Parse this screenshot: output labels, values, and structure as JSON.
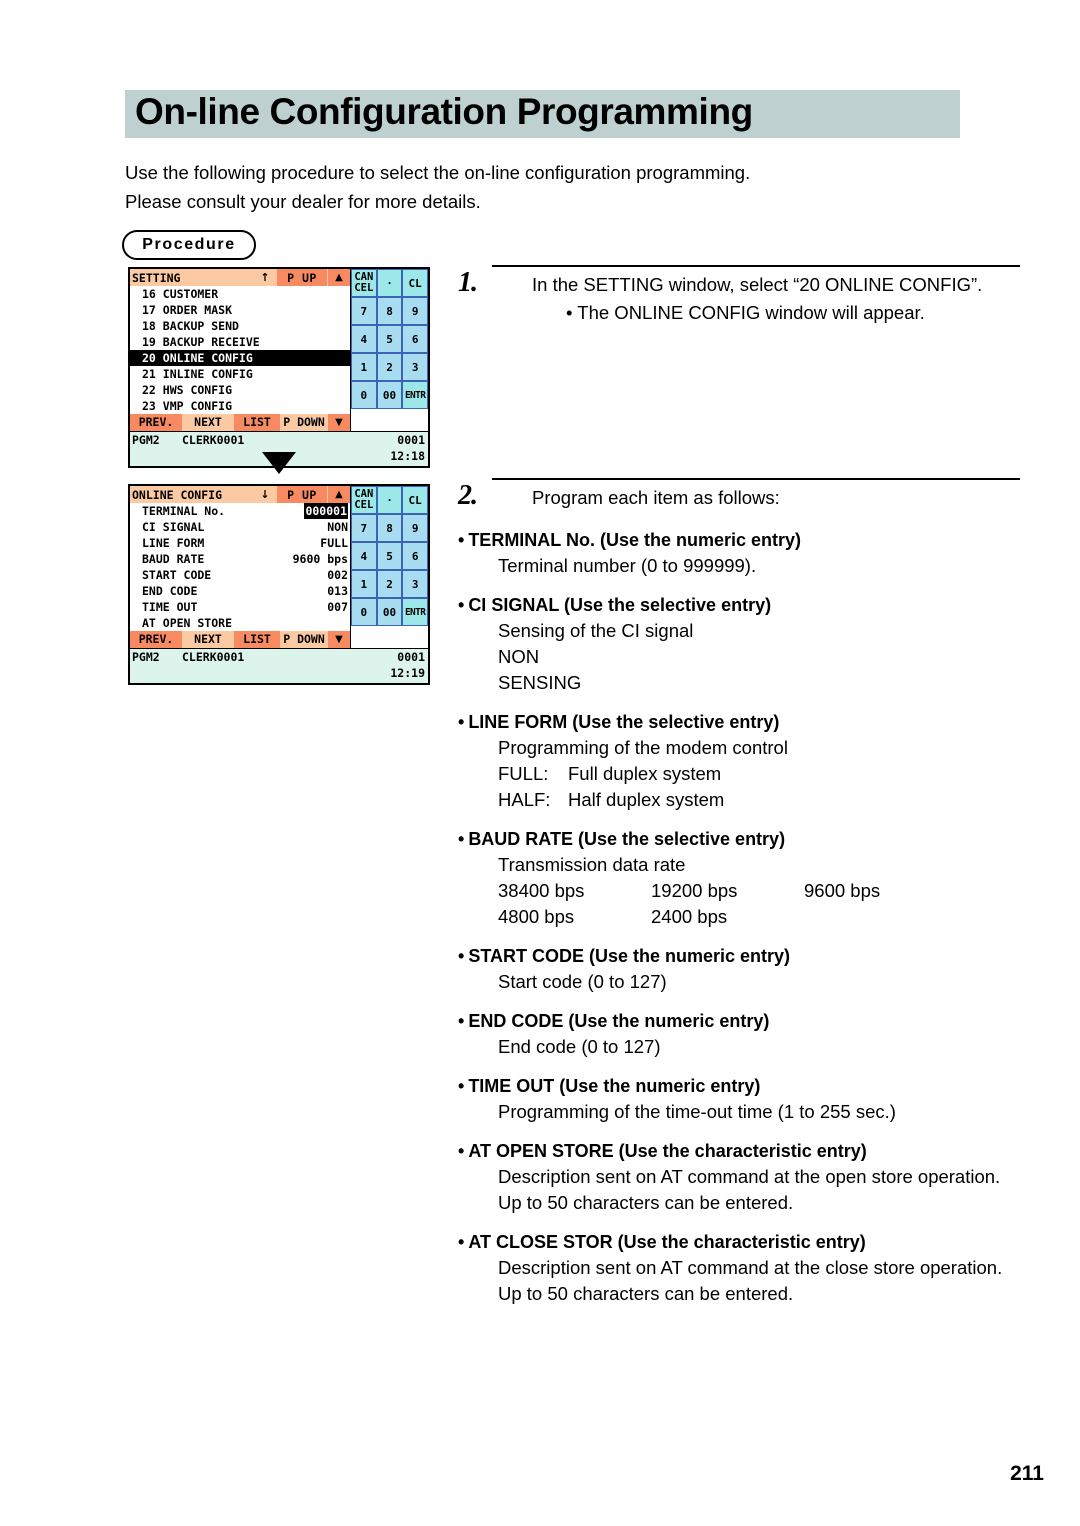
{
  "page": {
    "title": "On-line Configuration Programming",
    "intro_lines": [
      "Use the following procedure to select the on-line configuration programming.",
      "Please consult your dealer for more details."
    ],
    "procedure_label": "Procedure",
    "page_number": "211"
  },
  "screens": {
    "setting": {
      "header": {
        "title": "SETTING",
        "scroll_arrow": "↑",
        "page_up_label": "P UP",
        "page_up_arrow": "▲"
      },
      "rows": [
        {
          "label": "16 CUSTOMER",
          "value": "",
          "selected": false
        },
        {
          "label": "17 ORDER MASK",
          "value": "",
          "selected": false
        },
        {
          "label": "18 BACKUP SEND",
          "value": "",
          "selected": false
        },
        {
          "label": "19 BACKUP RECEIVE",
          "value": "",
          "selected": false
        },
        {
          "label": "20 ONLINE CONFIG",
          "value": "",
          "selected": true
        },
        {
          "label": "21 INLINE CONFIG",
          "value": "",
          "selected": false
        },
        {
          "label": "22 HWS CONFIG",
          "value": "",
          "selected": false
        },
        {
          "label": "23 VMP CONFIG",
          "value": "",
          "selected": false
        }
      ],
      "function_keys": [
        "PREV.",
        "NEXT",
        "LIST",
        "P DOWN",
        "▼"
      ],
      "status": {
        "mode": "PGM2",
        "clerk": "CLERK0001",
        "number": "0001",
        "time": "12:18"
      }
    },
    "online_config": {
      "header": {
        "title": "ONLINE CONFIG",
        "scroll_arrow": "↓",
        "page_up_label": "P UP",
        "page_up_arrow": "▲"
      },
      "rows": [
        {
          "label": "TERMINAL No.",
          "value": "000001",
          "highlighted": true
        },
        {
          "label": "CI SIGNAL",
          "value": "NON",
          "highlighted": false
        },
        {
          "label": "LINE FORM",
          "value": "FULL",
          "highlighted": false
        },
        {
          "label": "BAUD RATE",
          "value": "9600 bps",
          "highlighted": false
        },
        {
          "label": "START CODE",
          "value": "002",
          "highlighted": false
        },
        {
          "label": "END CODE",
          "value": "013",
          "highlighted": false
        },
        {
          "label": "TIME OUT",
          "value": "007",
          "highlighted": false
        },
        {
          "label": "AT OPEN STORE",
          "value": "",
          "highlighted": false
        }
      ],
      "function_keys": [
        "PREV.",
        "NEXT",
        "LIST",
        "P DOWN",
        "▼"
      ],
      "status": {
        "mode": "PGM2",
        "clerk": "CLERK0001",
        "number": "0001",
        "time": "12:19"
      }
    },
    "keypad": {
      "rows": [
        [
          {
            "top": "CAN",
            "bottom": "CEL",
            "style": "cyan"
          },
          {
            "top": "·",
            "bottom": "",
            "style": "cyan"
          },
          {
            "top": "CL",
            "bottom": "",
            "style": "cyan"
          }
        ],
        [
          {
            "top": "7",
            "bottom": "",
            "style": "blue"
          },
          {
            "top": "8",
            "bottom": "",
            "style": "blue"
          },
          {
            "top": "9",
            "bottom": "",
            "style": "blue"
          }
        ],
        [
          {
            "top": "4",
            "bottom": "",
            "style": "blue"
          },
          {
            "top": "5",
            "bottom": "",
            "style": "blue"
          },
          {
            "top": "6",
            "bottom": "",
            "style": "blue"
          }
        ],
        [
          {
            "top": "1",
            "bottom": "",
            "style": "blue"
          },
          {
            "top": "2",
            "bottom": "",
            "style": "blue"
          },
          {
            "top": "3",
            "bottom": "",
            "style": "blue"
          }
        ],
        [
          {
            "top": "0",
            "bottom": "",
            "style": "blue"
          },
          {
            "top": "00",
            "bottom": "",
            "style": "blue"
          },
          {
            "top": "ENTR",
            "bottom": "",
            "style": "cyan"
          }
        ]
      ]
    }
  },
  "steps": [
    {
      "number": "1.",
      "lead": "In the SETTING window, select “20 ONLINE CONFIG”.",
      "sub": "• The ONLINE CONFIG window will appear."
    },
    {
      "number": "2.",
      "lead": "Program each item as follows:",
      "sub": ""
    }
  ],
  "parameters": [
    {
      "heading": "TERMINAL No. (Use the numeric entry)",
      "lines": [
        "Terminal number (0 to 999999)."
      ]
    },
    {
      "heading": "CI SIGNAL (Use the selective entry)",
      "lines": [
        "Sensing of the CI signal",
        "NON",
        "SENSING"
      ]
    },
    {
      "heading": "LINE FORM (Use the selective entry)",
      "lines": [
        "Programming of the modem control"
      ],
      "pairs": [
        {
          "key": "FULL:",
          "value": "Full duplex system"
        },
        {
          "key": "HALF:",
          "value": "Half duplex system"
        }
      ]
    },
    {
      "heading": "BAUD RATE (Use the selective entry)",
      "lines": [
        "Transmission data rate"
      ],
      "columns": [
        [
          "38400 bps",
          "19200 bps",
          "9600 bps"
        ],
        [
          "4800 bps",
          "2400 bps",
          ""
        ]
      ]
    },
    {
      "heading": "START CODE (Use the numeric entry)",
      "lines": [
        "Start code (0 to 127)"
      ]
    },
    {
      "heading": "END CODE (Use the numeric entry)",
      "lines": [
        "End code (0 to 127)"
      ]
    },
    {
      "heading": "TIME OUT (Use the numeric entry)",
      "lines": [
        "Programming of the time-out time (1 to 255 sec.)"
      ]
    },
    {
      "heading": "AT OPEN STORE (Use the characteristic entry)",
      "lines": [
        "Description sent on AT command at the open store operation.",
        "Up to 50 characters can be entered."
      ]
    },
    {
      "heading": "AT CLOSE STOR (Use the characteristic entry)",
      "lines": [
        "Description sent on AT command at the close store operation.",
        "Up to 50 characters can be entered."
      ]
    }
  ]
}
